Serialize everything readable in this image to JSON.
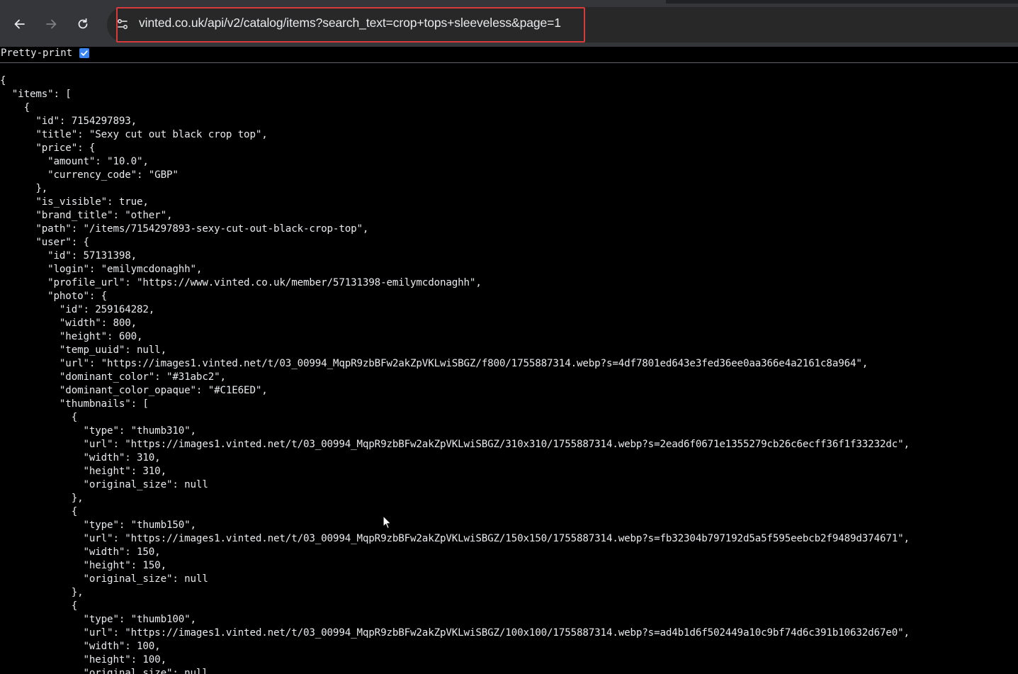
{
  "browser": {
    "url": "vinted.co.uk/api/v2/catalog/items?search_text=crop+tops+sleeveless&page=1",
    "nav_icons": [
      "back-arrow-icon",
      "forward-arrow-icon",
      "reload-icon",
      "site-info-icon"
    ],
    "highlight_color": "#d63a3a"
  },
  "viewer": {
    "pretty_print_label": "Pretty-print",
    "pretty_print_checked": true
  },
  "json_lines": [
    "{",
    "  \"items\": [",
    "    {",
    "      \"id\": 7154297893,",
    "      \"title\": \"Sexy cut out black crop top\",",
    "      \"price\": {",
    "        \"amount\": \"10.0\",",
    "        \"currency_code\": \"GBP\"",
    "      },",
    "      \"is_visible\": true,",
    "      \"brand_title\": \"other\",",
    "      \"path\": \"/items/7154297893-sexy-cut-out-black-crop-top\",",
    "      \"user\": {",
    "        \"id\": 57131398,",
    "        \"login\": \"emilymcdonaghh\",",
    "        \"profile_url\": \"https://www.vinted.co.uk/member/57131398-emilymcdonaghh\",",
    "        \"photo\": {",
    "          \"id\": 259164282,",
    "          \"width\": 800,",
    "          \"height\": 600,",
    "          \"temp_uuid\": null,",
    "          \"url\": \"https://images1.vinted.net/t/03_00994_MqpR9zbBFw2akZpVKLwiSBGZ/f800/1755887314.webp?s=4df7801ed643e3fed36ee0aa366e4a2161c8a964\",",
    "          \"dominant_color\": \"#31abc2\",",
    "          \"dominant_color_opaque\": \"#C1E6ED\",",
    "          \"thumbnails\": [",
    "            {",
    "              \"type\": \"thumb310\",",
    "              \"url\": \"https://images1.vinted.net/t/03_00994_MqpR9zbBFw2akZpVKLwiSBGZ/310x310/1755887314.webp?s=2ead6f0671e1355279cb26c6ecff36f1f33232dc\",",
    "              \"width\": 310,",
    "              \"height\": 310,",
    "              \"original_size\": null",
    "            },",
    "            {",
    "              \"type\": \"thumb150\",",
    "              \"url\": \"https://images1.vinted.net/t/03_00994_MqpR9zbBFw2akZpVKLwiSBGZ/150x150/1755887314.webp?s=fb32304b797192d5a5f595eebcb2f9489d374671\",",
    "              \"width\": 150,",
    "              \"height\": 150,",
    "              \"original_size\": null",
    "            },",
    "            {",
    "              \"type\": \"thumb100\",",
    "              \"url\": \"https://images1.vinted.net/t/03_00994_MqpR9zbBFw2akZpVKLwiSBGZ/100x100/1755887314.webp?s=ad4b1d6f502449a10c9bf74d6c391b10632d67e0\",",
    "              \"width\": 100,",
    "              \"height\": 100,",
    "              \"original_size\": null"
  ]
}
